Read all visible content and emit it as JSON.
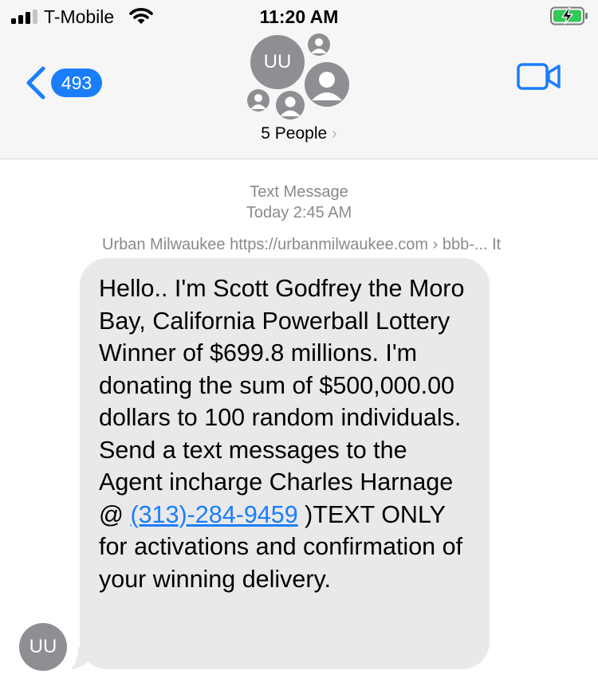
{
  "status_bar": {
    "carrier": "T-Mobile",
    "time": "11:20 AM",
    "signal_bars": 3,
    "battery_state": "charging"
  },
  "nav": {
    "back_badge": "493",
    "group_avatar_initials": "UU",
    "people_label": "5 People",
    "people_chevron": "›",
    "icons": [
      "back-chevron-icon",
      "video-camera-icon",
      "person-icon"
    ]
  },
  "conversation": {
    "message_type": "Text Message",
    "timestamp": "Today 2:45 AM",
    "sender_line": "Urban Milwaukee https://urbanmilwaukee.com › bbb-... It",
    "sender_avatar_initials": "UU",
    "message": {
      "text_before": "Hello.. I'm Scott Godfrey the Moro Bay, California Powerball Lottery Winner of $699.8 millions. I'm donating the sum of $500,000.00 dollars to 100 random individuals. Send a text messages to the Agent incharge Charles Harnage @ ",
      "phone": "(313)-284-9459",
      "text_after": " )TEXT ONLY for activations and confirmation of your winning delivery."
    }
  },
  "colors": {
    "accent": "#1a7efb",
    "bubble_bg": "#e9e9eb",
    "header_bg": "#f6f6f6",
    "avatar_gray": "#8e8e93",
    "meta_text": "#8a8a8e",
    "battery_green": "#34c759"
  }
}
